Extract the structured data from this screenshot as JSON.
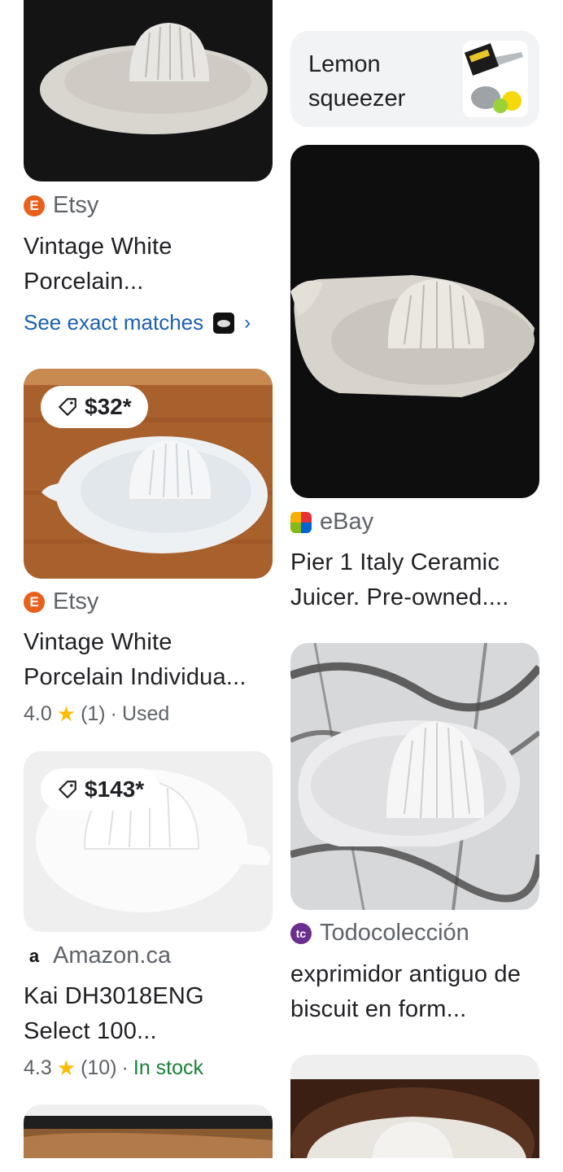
{
  "chip": {
    "label": "Lemon squeezer",
    "thumb_icon": "lemon-squeezer-thumbnail"
  },
  "left": [
    {
      "source": "Etsy",
      "source_icon": "etsy-icon",
      "title": "Vintage White Porcelain...",
      "exact_matches": "See exact matches"
    },
    {
      "price": "$32*",
      "source": "Etsy",
      "source_icon": "etsy-icon",
      "title": "Vintage White Porcelain Individua...",
      "rating": "4.0",
      "reviews": "(1)",
      "condition": "Used"
    },
    {
      "price": "$143*",
      "source": "Amazon.ca",
      "source_icon": "amazon-icon",
      "title": "Kai DH3018ENG Select 100...",
      "rating": "4.3",
      "reviews": "(10)",
      "availability": "In stock"
    }
  ],
  "right": [
    {
      "source": "eBay",
      "source_icon": "ebay-icon",
      "title": "Pier 1 Italy Ceramic Juicer. Pre-owned...."
    },
    {
      "source": "Todocolección",
      "source_icon": "todocoleccion-icon",
      "title": "exprimidor antiguo de biscuit en form..."
    }
  ],
  "colors": {
    "link": "#1a5fb4",
    "in_stock": "#188038",
    "star": "#fbbc04",
    "etsy": "#e8601c"
  }
}
